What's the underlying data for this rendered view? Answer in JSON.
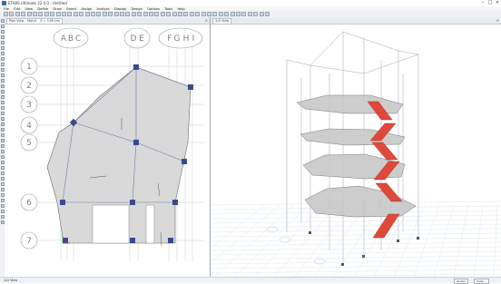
{
  "window": {
    "title": "ETABS Ultimate 22.0.0 - Untitled"
  },
  "menu": [
    "File",
    "Edit",
    "View",
    "Define",
    "Draw",
    "Select",
    "Assign",
    "Analyze",
    "Display",
    "Design",
    "Options",
    "Tools",
    "Help"
  ],
  "left_view": {
    "tab_title": "Plan View - Story1 - Z = 3.00 (m)"
  },
  "right_view": {
    "tab_title": "3-D View"
  },
  "grids": {
    "columns": [
      "A",
      "B",
      "C",
      "D",
      "E",
      "F",
      "G",
      "H",
      "I"
    ],
    "rows": [
      "1",
      "2",
      "3",
      "4",
      "5",
      "6",
      "7"
    ]
  },
  "status": {
    "left": "3-D View",
    "units": "Global",
    "unit_system": "Units..."
  },
  "colors": {
    "accent": "#3a6fb0",
    "slab": "#d9d9d9",
    "column_node": "#3b4a8f",
    "stair": "#e0483a",
    "grid": "#c9ced6"
  }
}
